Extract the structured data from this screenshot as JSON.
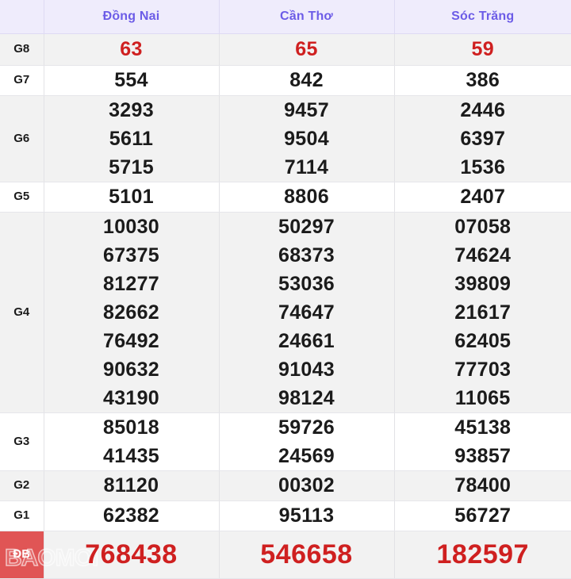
{
  "table": {
    "label_column_header": "",
    "columns": [
      {
        "name": "Đồng Nai"
      },
      {
        "name": "Cần Thơ"
      },
      {
        "name": "Sóc Trăng"
      }
    ],
    "colors": {
      "header_bg": "#efecfc",
      "header_text": "#6c5ce7",
      "stripe_bg": "#f2f2f2",
      "row_bg": "#ffffff",
      "number_text": "#1b1b1b",
      "highlight_text": "#cf2020",
      "special_label_bg": "#e05555",
      "special_label_text": "#ffffff",
      "border": "#e2e2e6"
    },
    "rows": [
      {
        "label": "G8",
        "highlight": true,
        "stripe": true,
        "values": [
          [
            "63"
          ],
          [
            "65"
          ],
          [
            "59"
          ]
        ]
      },
      {
        "label": "G7",
        "highlight": false,
        "stripe": false,
        "values": [
          [
            "554"
          ],
          [
            "842"
          ],
          [
            "386"
          ]
        ]
      },
      {
        "label": "G6",
        "highlight": false,
        "stripe": true,
        "values": [
          [
            "3293",
            "5611",
            "5715"
          ],
          [
            "9457",
            "9504",
            "7114"
          ],
          [
            "2446",
            "6397",
            "1536"
          ]
        ]
      },
      {
        "label": "G5",
        "highlight": false,
        "stripe": false,
        "values": [
          [
            "5101"
          ],
          [
            "8806"
          ],
          [
            "2407"
          ]
        ]
      },
      {
        "label": "G4",
        "highlight": false,
        "stripe": true,
        "values": [
          [
            "10030",
            "67375",
            "81277",
            "82662",
            "76492",
            "90632",
            "43190"
          ],
          [
            "50297",
            "68373",
            "53036",
            "74647",
            "24661",
            "91043",
            "98124"
          ],
          [
            "07058",
            "74624",
            "39809",
            "21617",
            "62405",
            "77703",
            "11065"
          ]
        ]
      },
      {
        "label": "G3",
        "highlight": false,
        "stripe": false,
        "values": [
          [
            "85018",
            "41435"
          ],
          [
            "59726",
            "24569"
          ],
          [
            "45138",
            "93857"
          ]
        ]
      },
      {
        "label": "G2",
        "highlight": false,
        "stripe": true,
        "values": [
          [
            "81120"
          ],
          [
            "00302"
          ],
          [
            "78400"
          ]
        ]
      },
      {
        "label": "G1",
        "highlight": false,
        "stripe": false,
        "values": [
          [
            "62382"
          ],
          [
            "95113"
          ],
          [
            "56727"
          ]
        ]
      }
    ],
    "special_row": {
      "label": "ĐB",
      "values": [
        [
          "768438"
        ],
        [
          "546658"
        ],
        [
          "182597"
        ]
      ]
    }
  },
  "watermark": {
    "text": "BAOMOI"
  }
}
